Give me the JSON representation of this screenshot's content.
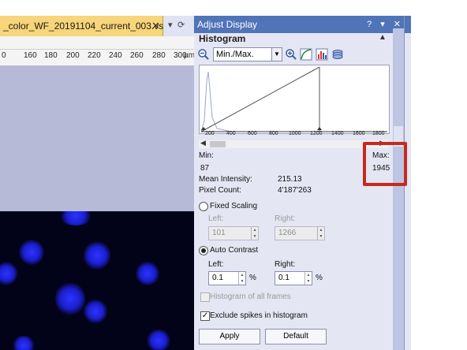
{
  "document_tab": {
    "title": "_color_WF_20191104_current_003.vsi",
    "close": "✕",
    "pin": "▾",
    "nav": "⟳"
  },
  "ruler": {
    "ticks": [
      "160",
      "180",
      "200",
      "220",
      "240",
      "260",
      "280",
      "300"
    ],
    "unit": "µm",
    "lead": "0"
  },
  "panel": {
    "title": "Adjust Display",
    "controls": "? ▾ ✕",
    "section": "Histogram",
    "mode_value": "Min./Max.",
    "histogram_ticks": [
      "200",
      "400",
      "600",
      "800",
      "1000",
      "1200",
      "1400",
      "1600",
      "1800"
    ],
    "min_label": "Min:",
    "min_value": "87",
    "max_label": "Max:",
    "max_value": "1945",
    "mean_label": "Mean Intensity:",
    "mean_value": "215.13",
    "count_label": "Pixel Count:",
    "count_value": "4'187'263",
    "fixed_scaling": "Fixed Scaling",
    "fixed_left_label": "Left:",
    "fixed_right_label": "Right:",
    "fixed_left_value": "101",
    "fixed_right_value": "1266",
    "auto_contrast": "Auto Contrast",
    "auto_left_label": "Left:",
    "auto_right_label": "Right:",
    "auto_left_value": "0.1",
    "auto_right_value": "0.1",
    "percent": "%",
    "histogram_all_frames": "Histogram of all frames",
    "exclude_spikes": "Exclude spikes in histogram",
    "apply": "Apply",
    "default": "Default"
  },
  "colors": {
    "accent": "#4f74b8",
    "highlight": "#c62a1e",
    "tab": "#f7d57a",
    "nuclei": "#2c34ff"
  }
}
